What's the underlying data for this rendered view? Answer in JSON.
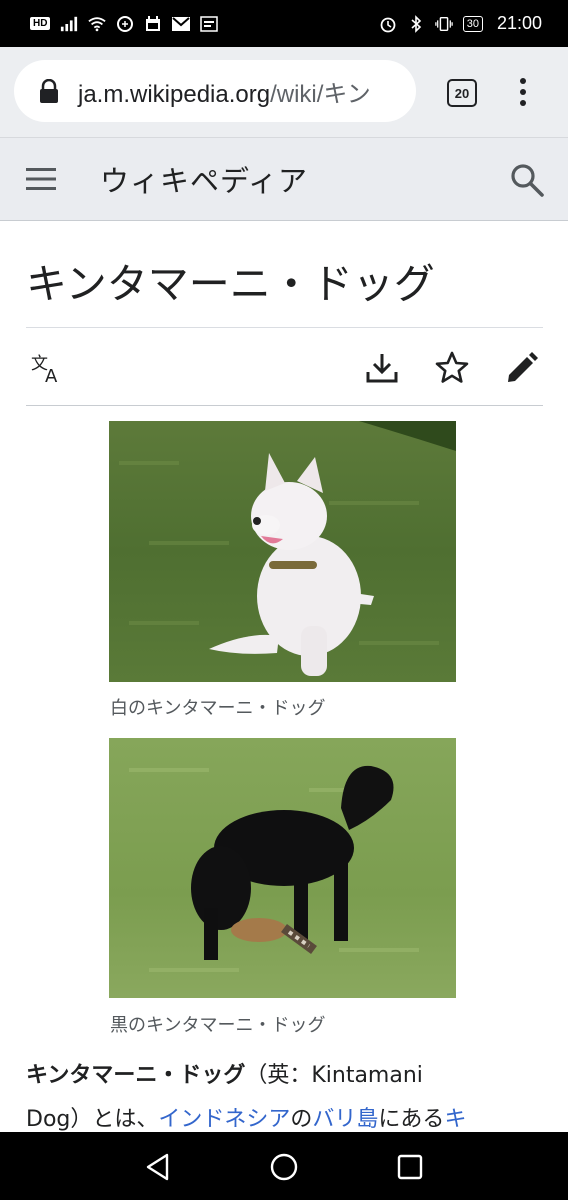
{
  "status_bar": {
    "hd": "HD",
    "battery": "30",
    "time": "21:00"
  },
  "browser": {
    "url_host": "ja.m.wikipedia.org",
    "url_path": "/wiki/キン",
    "tab_count": "20"
  },
  "wiki_header": {
    "brand": "ウィキペディア"
  },
  "article": {
    "title": "キンタマーニ・ドッグ",
    "figures": [
      {
        "caption": "白のキンタマーニ・ドッグ"
      },
      {
        "caption": "黒のキンタマーニ・ドッグ"
      }
    ],
    "intro": {
      "bold_term": "キンタマーニ・ドッグ",
      "paren_open": "（英：Kintamani",
      "line2_a": "Dog）とは、",
      "link1": "インドネシア",
      "line2_b": "の",
      "link2": "バリ島",
      "line2_c": "にある",
      "link3": "キ"
    }
  },
  "colors": {
    "link": "#3366cc",
    "header_bg": "#eaecf0",
    "urlbar_bg": "#eceef1"
  },
  "icons": [
    "hamburger-icon",
    "search-icon",
    "translate-icon",
    "download-icon",
    "star-icon",
    "edit-icon",
    "lock-icon",
    "more-vert-icon",
    "back-icon",
    "home-icon",
    "recents-icon"
  ]
}
